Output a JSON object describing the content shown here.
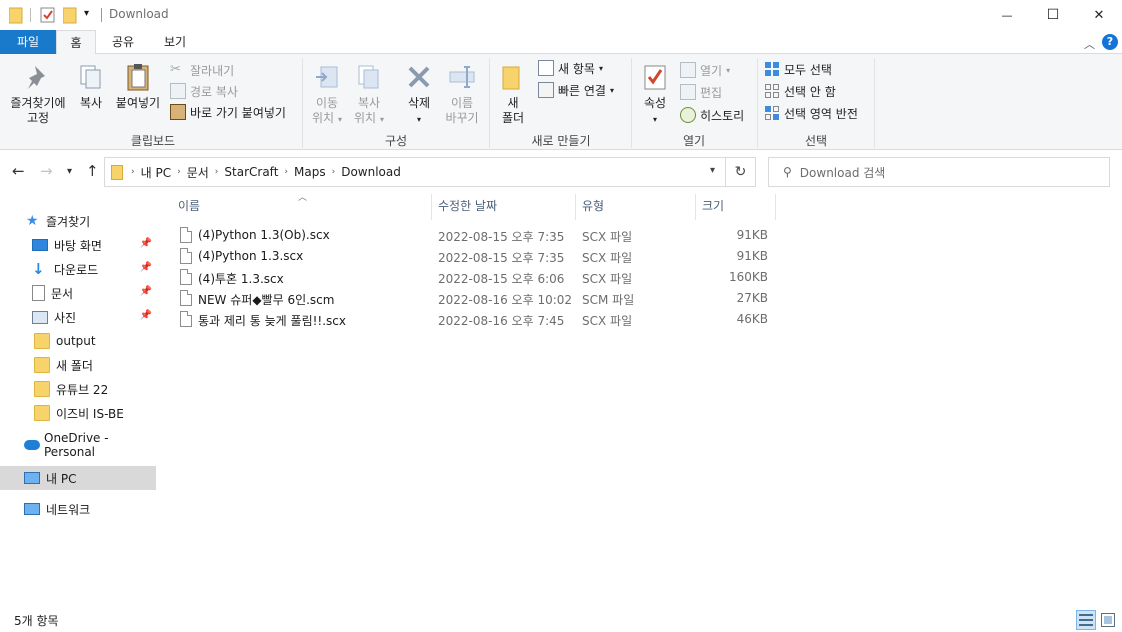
{
  "window": {
    "title": "Download",
    "minimize_glyph": "—",
    "maximize_glyph": "☐",
    "close_glyph": "✕"
  },
  "ribbon_tabs": [
    "파일",
    "홈",
    "공유",
    "보기"
  ],
  "ribbon": {
    "clipboard": {
      "group_label": "클립보드",
      "pin_line1": "즐겨찾기에",
      "pin_line2": "고정",
      "copy": "복사",
      "paste": "붙여넣기",
      "cut": "잘라내기",
      "copy_path": "경로 복사",
      "paste_shortcut": "바로 가기 붙여넣기"
    },
    "organize": {
      "group_label": "구성",
      "move_line1": "이동",
      "move_line2": "위치",
      "copy_line1": "복사",
      "copy_line2": "위치",
      "delete": "삭제",
      "rename_line1": "이름",
      "rename_line2": "바꾸기"
    },
    "new": {
      "group_label": "새로 만들기",
      "new_folder_line1": "새",
      "new_folder_line2": "폴더",
      "new_item": "새 항목",
      "easy_access": "빠른 연결"
    },
    "open": {
      "group_label": "열기",
      "properties": "속성",
      "open": "열기",
      "edit": "편집",
      "history": "히스토리"
    },
    "select": {
      "group_label": "선택",
      "select_all": "모두 선택",
      "select_none": "선택 안 함",
      "invert": "선택 영역 반전"
    }
  },
  "address": {
    "crumbs": [
      "내 PC",
      "문서",
      "StarCraft",
      "Maps",
      "Download"
    ]
  },
  "search": {
    "placeholder": "Download 검색"
  },
  "nav_pane": {
    "quick_access": "즐겨찾기",
    "items": [
      {
        "label": "바탕 화면",
        "icon": "desktop-icon",
        "pinned": true
      },
      {
        "label": "다운로드",
        "icon": "download-icon",
        "pinned": true
      },
      {
        "label": "문서",
        "icon": "document-icon",
        "pinned": true
      },
      {
        "label": "사진",
        "icon": "picture-icon",
        "pinned": true
      },
      {
        "label": "output",
        "icon": "folder-icon",
        "pinned": false
      },
      {
        "label": "새 폴더",
        "icon": "folder-icon",
        "pinned": false
      },
      {
        "label": "유튜브 22",
        "icon": "folder-icon",
        "pinned": false
      },
      {
        "label": "이즈비 IS-BE",
        "icon": "folder-icon",
        "pinned": false
      }
    ],
    "onedrive": "OneDrive - Personal",
    "this_pc": "내 PC",
    "network": "네트워크"
  },
  "columns": {
    "name": "이름",
    "modified": "수정한 날짜",
    "type": "유형",
    "size": "크기"
  },
  "files": [
    {
      "name": "(4)Python 1.3(Ob).scx",
      "modified": "2022-08-15 오후 7:35",
      "type": "SCX 파일",
      "size": "91KB"
    },
    {
      "name": "(4)Python 1.3.scx",
      "modified": "2022-08-15 오후 7:35",
      "type": "SCX 파일",
      "size": "91KB"
    },
    {
      "name": "(4)투혼 1.3.scx",
      "modified": "2022-08-15 오후 6:06",
      "type": "SCX 파일",
      "size": "160KB"
    },
    {
      "name": "NEW 슈퍼◆빨무 6인.scm",
      "modified": "2022-08-16 오후 10:02",
      "type": "SCM 파일",
      "size": "27KB"
    },
    {
      "name": "통과 제리 통 늦게 풀림!!.scx",
      "modified": "2022-08-16 오후 7:45",
      "type": "SCX 파일",
      "size": "46KB"
    }
  ],
  "status": {
    "item_count": "5개 항목"
  },
  "colors": {
    "file_tab": "#1979ca",
    "selection": "#d9d9d9",
    "folder": "#f6d46b"
  }
}
